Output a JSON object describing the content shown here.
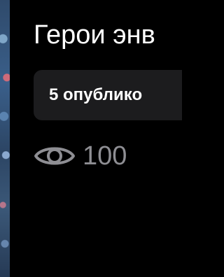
{
  "header": {
    "title": "Герои энв"
  },
  "chip": {
    "label": "5 опублико"
  },
  "stats": {
    "views_icon": "eye-icon",
    "views_count": "100"
  },
  "colors": {
    "background": "#000000",
    "chip_background": "#1c1c1e",
    "title_text": "#ffffff",
    "muted_text": "#8e8e93"
  }
}
